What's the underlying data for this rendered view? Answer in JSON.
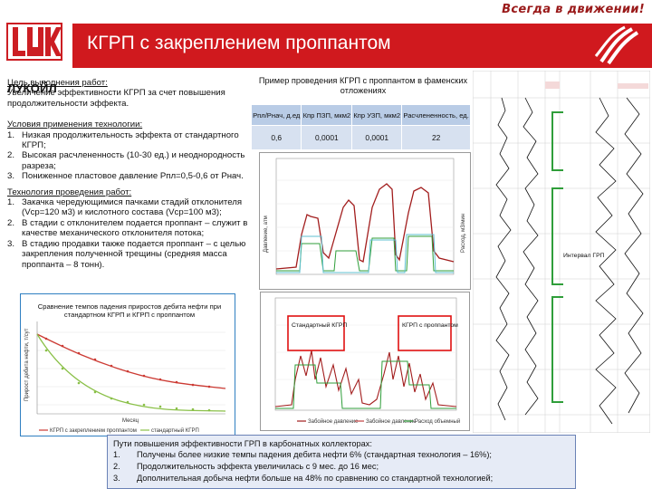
{
  "slogan": "Всегда в движении!",
  "brand": "ЛУКОЙЛ",
  "title": "КГРП с закреплением проппантом",
  "goal": {
    "heading": "Цель выполнения работ:",
    "text": "Увеличение эффективности КГРП за счет повышения продолжительности эффекта."
  },
  "conditions": {
    "heading": "Условия применения технологии:",
    "items": [
      "Низкая продолжительность эффекта от стандартного КГРП;",
      "Высокая расчлененность (10-30 ед.) и неоднородность разреза;",
      "Пониженное пластовое давление Рпл=0,5-0,6 от Рнач."
    ]
  },
  "technology": {
    "heading": "Технология проведения работ:",
    "items": [
      "Закачка чередующимися пачками стадий отклонителя (Vср=120 м3) и кислотного состава (Vср=100 м3);",
      "В стадии с отклонителем подается проппант – служит в качестве механического отклонителя потока;",
      "В стадию продавки также подается проппант – с целью закрепления полученной трещины (средняя масса проппанта – 8 тонн)."
    ]
  },
  "table": {
    "title": "Пример проведения КГРП с проппантом в фаменских отложениях",
    "headers": [
      "Рпл/Рнач, д.ед",
      "Кпр ПЗП, мкм2",
      "Кпр УЗП, мкм2",
      "Расчлененность, ед."
    ],
    "values": [
      "0,6",
      "0,0001",
      "0,0001",
      "22"
    ]
  },
  "decline_chart": {
    "title": "Сравнение темпов падения приростов дебита нефти при стандартном КГРП и КГРП с проппантом",
    "ylabel": "Прирост дебита нефти, т/сут",
    "xlabel": "Месяц",
    "legend": [
      "КГРП с закреплением проппантом",
      "стандартный КГРП"
    ]
  },
  "process_chart_top": {
    "left_axis_label": "Давление, атм",
    "right_axis_label": "Расход, м3/мин"
  },
  "process_chart_bottom": {
    "label_standard": "Стандартный КГРП",
    "label_proppant": "КГРП с проппантом",
    "legend": [
      "Забойное давление",
      "Забойное давление",
      "Расход объемный"
    ]
  },
  "log_panel": {
    "interval_label": "Интервал ГРП"
  },
  "summary": {
    "heading": "Пути повышения эффективности ГРП в карбонатных коллекторах:",
    "items": [
      {
        "num": "1.",
        "text": "Получены более низкие темпы падения дебита нефти 6% (стандартная технология – 16%);"
      },
      {
        "num": "2.",
        "text": "Продолжительность эффекта увеличилась с 9 мес. до 16 мес;"
      },
      {
        "num": "3.",
        "text": "Дополнительная добыча нефти больше на 48% по сравнению со стандартной технологией;"
      }
    ]
  },
  "colors": {
    "brand_red": "#d0191e",
    "pressure": "#a21d1d",
    "rate": "#2f9e3a",
    "density": "#5fc0d0",
    "decline_proppant": "#cc3a33",
    "decline_standard": "#8ac048",
    "summary_bg": "#e6ebf6"
  }
}
